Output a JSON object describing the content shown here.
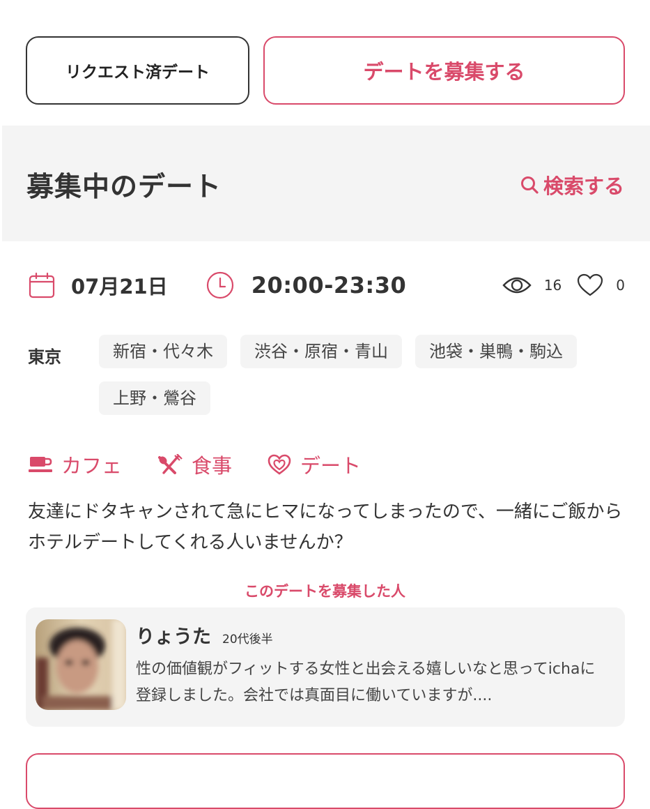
{
  "top_buttons": {
    "requested_label": "リクエスト済デート",
    "post_label": "デートを募集する"
  },
  "section": {
    "title": "募集中のデート",
    "search_label": "検索する"
  },
  "date_card": {
    "date": "07月21日",
    "time": "20:00-23:30",
    "views": "16",
    "likes": "0",
    "area_label": "東京",
    "area_tags": [
      "新宿・代々木",
      "渋谷・原宿・青山",
      "池袋・巣鴨・駒込",
      "上野・鶯谷"
    ],
    "categories": [
      {
        "label": "カフェ",
        "icon": "cafe-icon"
      },
      {
        "label": "食事",
        "icon": "meal-icon"
      },
      {
        "label": "デート",
        "icon": "date-heart-icon"
      }
    ],
    "description": "友達にドタキャンされて急にヒマになってしまったので、一緒にご飯からホテルデートしてくれる人いませんか？"
  },
  "poster": {
    "heading": "このデートを募集した人",
    "name": "りょうた",
    "age": "20代後半",
    "bio": "性の価値観がフィットする女性と出会える嬉しいなと思ってichaに登録しました。会社では真面目に働いていますが...."
  },
  "colors": {
    "accent": "#d94a6a",
    "text": "#333333",
    "band": "#f4f4f4"
  }
}
